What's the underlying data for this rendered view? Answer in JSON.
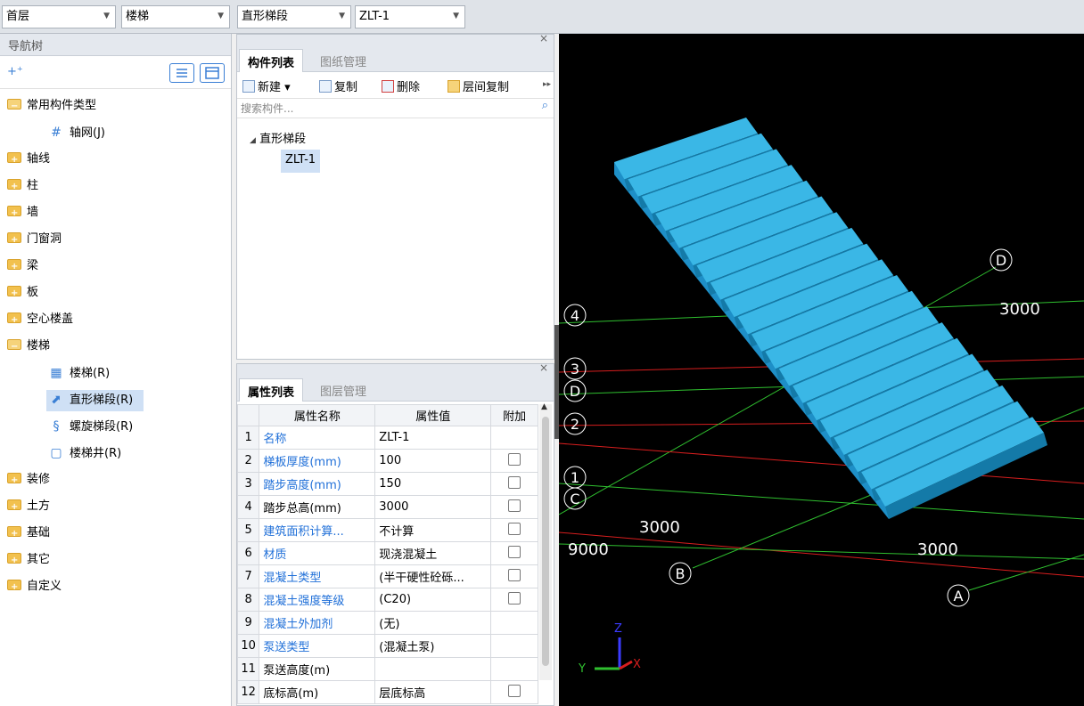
{
  "topbar": {
    "floor": "首层",
    "category": "楼梯",
    "type": "直形梯段",
    "component": "ZLT-1"
  },
  "nav": {
    "title": "导航树",
    "items": [
      {
        "label": "常用构件类型",
        "open": true
      },
      {
        "label": "轴网(J)",
        "child": true
      },
      {
        "label": "轴线"
      },
      {
        "label": "柱"
      },
      {
        "label": "墙"
      },
      {
        "label": "门窗洞"
      },
      {
        "label": "梁"
      },
      {
        "label": "板"
      },
      {
        "label": "空心楼盖"
      },
      {
        "label": "楼梯",
        "open": true
      },
      {
        "label": "楼梯(R)",
        "child": true
      },
      {
        "label": "直形梯段(R)",
        "child": true,
        "selected": true
      },
      {
        "label": "螺旋梯段(R)",
        "child": true
      },
      {
        "label": "楼梯井(R)",
        "child": true
      },
      {
        "label": "装修"
      },
      {
        "label": "土方"
      },
      {
        "label": "基础"
      },
      {
        "label": "其它"
      },
      {
        "label": "自定义"
      }
    ]
  },
  "components_panel": {
    "tabs": [
      "构件列表",
      "图纸管理"
    ],
    "toolbar": [
      "新建",
      "复制",
      "删除",
      "层间复制"
    ],
    "search_placeholder": "搜索构件...",
    "group": "直形梯段",
    "item": "ZLT-1"
  },
  "props_panel": {
    "tabs": [
      "属性列表",
      "图层管理"
    ],
    "headers": [
      "属性名称",
      "属性值",
      "附加"
    ],
    "rows": [
      {
        "n": "1",
        "name": "名称",
        "value": "ZLT-1",
        "blue": true,
        "check": false
      },
      {
        "n": "2",
        "name": "梯板厚度(mm)",
        "value": "100",
        "blue": true,
        "check": true
      },
      {
        "n": "3",
        "name": "踏步高度(mm)",
        "value": "150",
        "blue": true,
        "check": true
      },
      {
        "n": "4",
        "name": "踏步总高(mm)",
        "value": "3000",
        "blue": false,
        "check": true
      },
      {
        "n": "5",
        "name": "建筑面积计算...",
        "value": "不计算",
        "blue": true,
        "check": true
      },
      {
        "n": "6",
        "name": "材质",
        "value": "现浇混凝土",
        "blue": true,
        "check": true
      },
      {
        "n": "7",
        "name": "混凝土类型",
        "value": "(半干硬性砼砾...",
        "blue": true,
        "check": true
      },
      {
        "n": "8",
        "name": "混凝土强度等级",
        "value": "(C20)",
        "blue": true,
        "check": true
      },
      {
        "n": "9",
        "name": "混凝土外加剂",
        "value": "(无)",
        "blue": true,
        "check": false
      },
      {
        "n": "10",
        "name": "泵送类型",
        "value": "(混凝土泵)",
        "blue": true,
        "check": false
      },
      {
        "n": "11",
        "name": "泵送高度(m)",
        "value": "",
        "blue": false,
        "check": false
      },
      {
        "n": "12",
        "name": "底标高(m)",
        "value": "层底标高",
        "blue": false,
        "check": true
      }
    ]
  },
  "viewport": {
    "axis_labels": [
      "4",
      "3",
      "D",
      "2",
      "1",
      "C",
      "B",
      "A",
      "D"
    ],
    "dims": [
      "3000",
      "3000",
      "9000",
      "3000"
    ],
    "steps": 20,
    "colors": {
      "stair_top": "#3ab7e6",
      "stair_side": "#1e8fc7",
      "stair_dark": "#147aa8",
      "grid_green": "#2fbf2f",
      "grid_red": "#d81e1e"
    },
    "axes": {
      "z": "Z",
      "y": "Y",
      "x": "X"
    }
  }
}
